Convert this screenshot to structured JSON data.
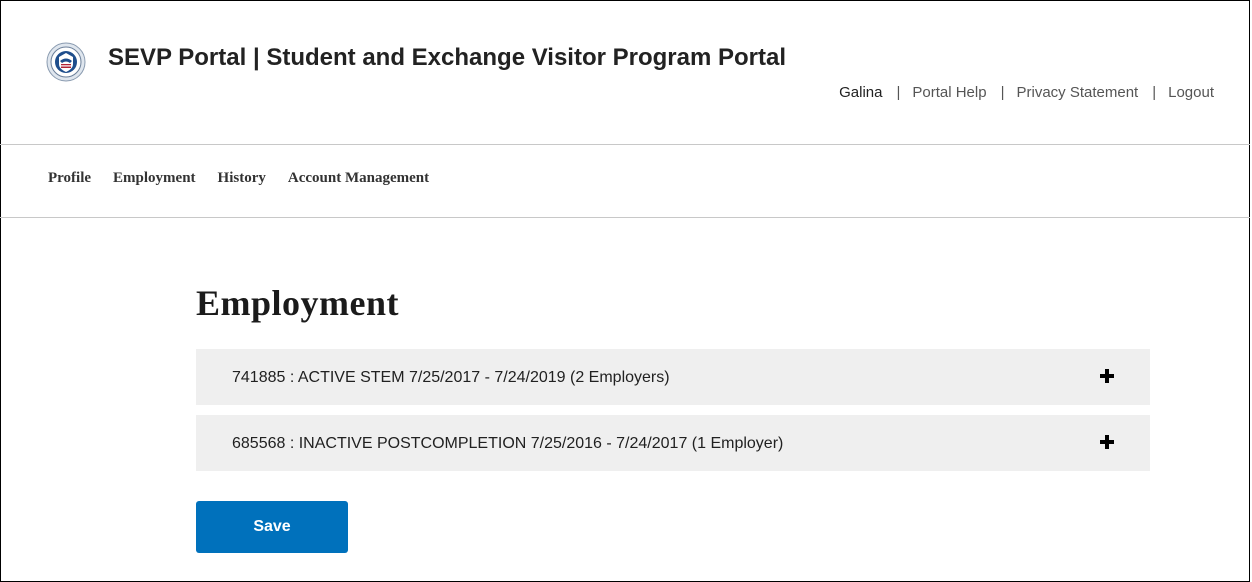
{
  "header": {
    "logo_icon": "dhs-seal-icon",
    "title": "SEVP Portal | Student and Exchange Visitor Program Portal",
    "user_name": "Galina",
    "links": {
      "portal_help": "Portal Help",
      "privacy_statement": "Privacy Statement",
      "logout": "Logout"
    },
    "separator": "|"
  },
  "nav": {
    "items": [
      {
        "label": "Profile"
      },
      {
        "label": "Employment"
      },
      {
        "label": "History"
      },
      {
        "label": "Account Management"
      }
    ]
  },
  "main": {
    "title": "Employment",
    "accordion": [
      {
        "label": "741885 : ACTIVE STEM 7/25/2017 - 7/24/2019 (2 Employers)",
        "icon": "plus-icon"
      },
      {
        "label": "685568 : INACTIVE POSTCOMPLETION 7/25/2016 - 7/24/2017 (1 Employer)",
        "icon": "plus-icon"
      }
    ],
    "save_label": "Save"
  },
  "colors": {
    "accent": "#0071bc",
    "accordion_bg": "#efefef",
    "divider": "#c8c8c8"
  }
}
